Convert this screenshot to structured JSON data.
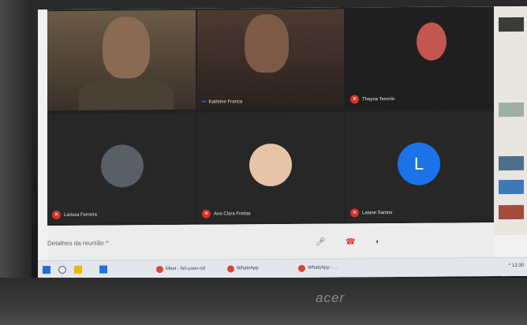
{
  "brand": "acer",
  "meet": {
    "participants": [
      {
        "id": "p1",
        "name": "",
        "state": "speaking"
      },
      {
        "id": "p2",
        "name": "Kathrine Franca",
        "state": "speaking"
      },
      {
        "id": "p3",
        "name": "Thayna Tenorio",
        "state": "muted"
      },
      {
        "id": "p4",
        "name": "Larissa Ferreira",
        "state": "muted"
      },
      {
        "id": "p5",
        "name": "Ana Clara Freitas",
        "state": "muted"
      },
      {
        "id": "p6",
        "name": "Laiane Santos",
        "state": "muted",
        "avatar_letter": "L"
      }
    ],
    "meeting_code": "Detalhes da reunião",
    "meeting_code_chevron": "^"
  },
  "taskbar": {
    "buttons": [
      {
        "label": "Meet - fxh-yaav-nd"
      },
      {
        "label": "WhatsApp"
      },
      {
        "label": "WhatsApp - ..."
      }
    ],
    "clock": "^ 12:30"
  },
  "colors": {
    "mute": "#d93025",
    "meet_bg": "#202124",
    "avatar": "#1a73e8"
  }
}
